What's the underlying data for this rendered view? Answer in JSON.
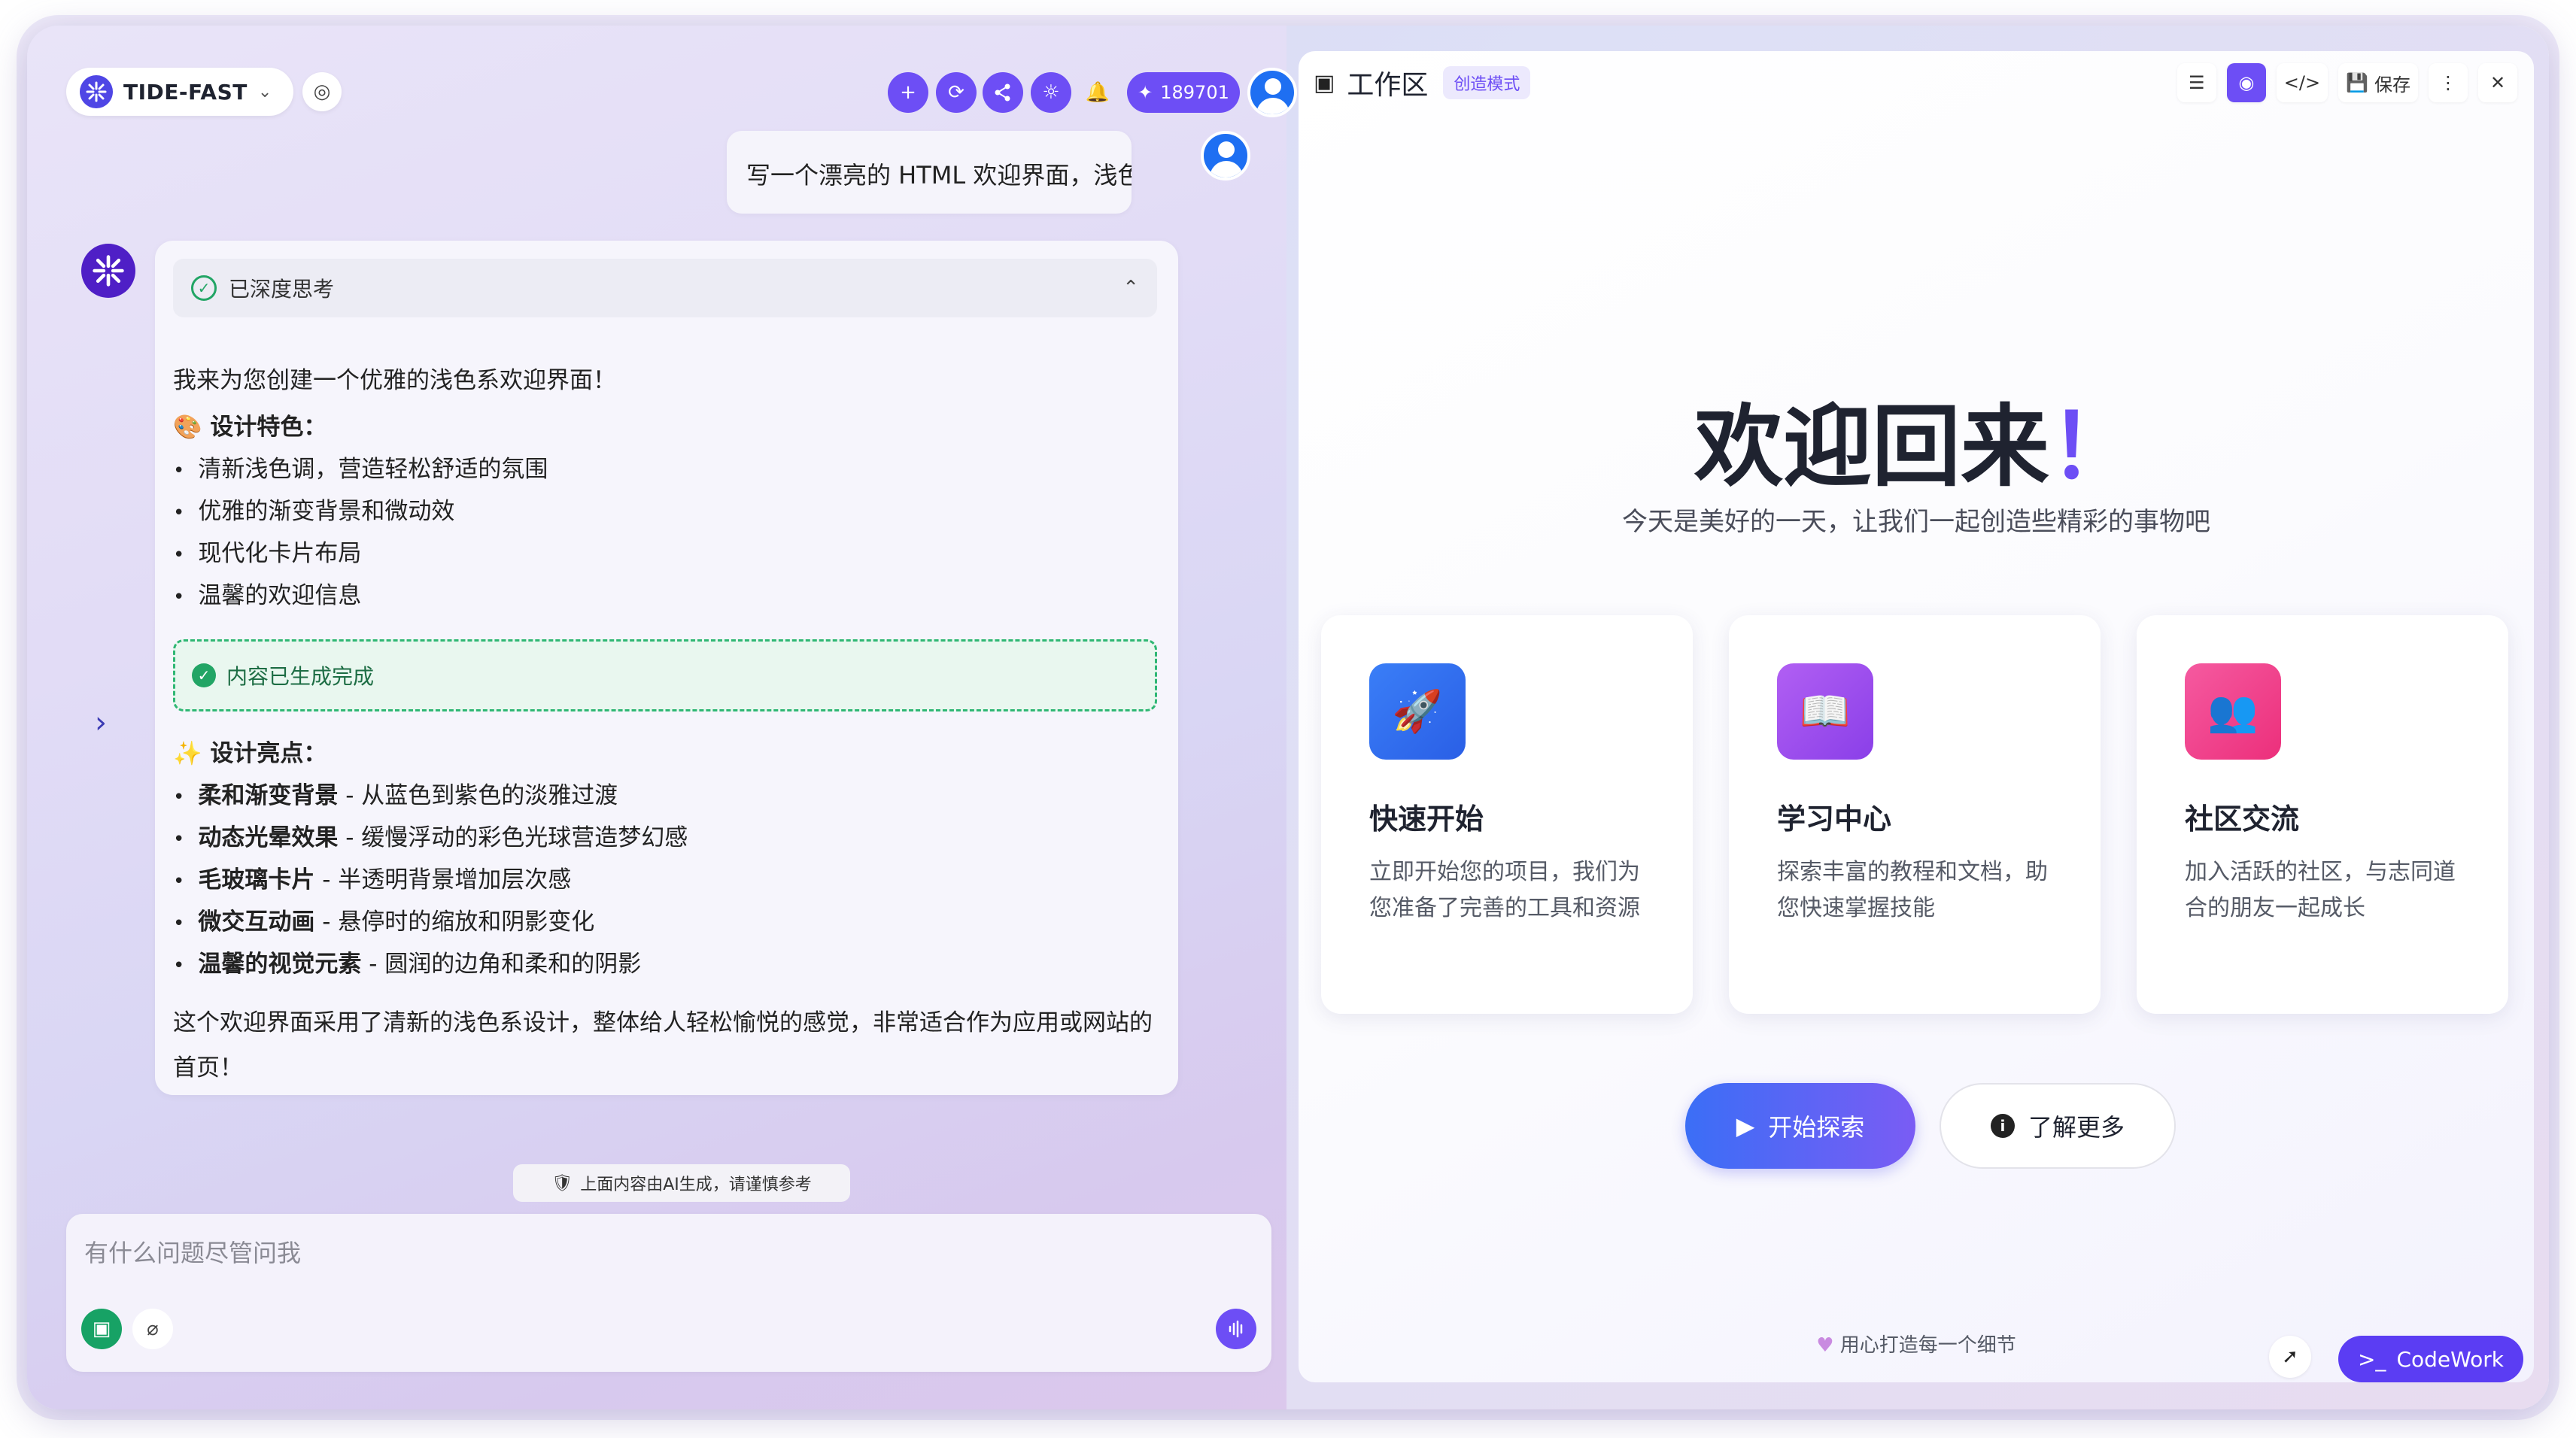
{
  "colors": {
    "accent": "#6d4ef5",
    "success": "#22a565",
    "brand_logo": "#4f46e5",
    "card_blue": "#2f6ff2",
    "card_purple": "#9b4ff0",
    "card_pink": "#f0408a"
  },
  "left": {
    "brand": "TIDE-FAST",
    "credits": "189701",
    "toolbar_icons": [
      "plus-icon",
      "refresh-icon",
      "share-icon",
      "sun-icon",
      "bell-icon",
      "sparkle-icon"
    ],
    "user_message": "写一个漂亮的 HTML 欢迎界面，浅色,",
    "thinking_label": "已深度思考",
    "intro": "我来为您创建一个优雅的浅色系欢迎界面！",
    "features_heading": "🎨 设计特色：",
    "features": [
      "清新浅色调，营造轻松舒适的氛围",
      "优雅的渐变背景和微动效",
      "现代化卡片布局",
      "温馨的欢迎信息"
    ],
    "done_label": "内容已生成完成",
    "highlights_heading": "✨ 设计亮点：",
    "highlights": [
      {
        "title": "柔和渐变背景",
        "desc": " - 从蓝色到紫色的淡雅过渡"
      },
      {
        "title": "动态光晕效果",
        "desc": " - 缓慢浮动的彩色光球营造梦幻感"
      },
      {
        "title": "毛玻璃卡片",
        "desc": " - 半透明背景增加层次感"
      },
      {
        "title": "微交互动画",
        "desc": " - 悬停时的缩放和阴影变化"
      },
      {
        "title": "温馨的视觉元素",
        "desc": " - 圆润的边角和柔和的阴影"
      }
    ],
    "summary": "这个欢迎界面采用了清新的浅色系设计，整体给人轻松愉悦的感觉，非常适合作为应用或网站的首页！",
    "disclaimer": "上面内容由AI生成，请谨慎参考",
    "input_placeholder": "有什么问题尽管问我"
  },
  "right": {
    "title": "工作区",
    "mode": "创造模式",
    "save_label": "保存",
    "hero_title": "欢迎回来",
    "hero_bang": "！",
    "hero_subtitle": "今天是美好的一天，让我们一起创造些精彩的事物吧",
    "cards": [
      {
        "icon": "rocket-icon",
        "title": "快速开始",
        "desc": "立即开始您的项目，我们为您准备了完善的工具和资源"
      },
      {
        "icon": "book-icon",
        "title": "学习中心",
        "desc": "探索丰富的教程和文档，助您快速掌握技能"
      },
      {
        "icon": "users-icon",
        "title": "社区交流",
        "desc": "加入活跃的社区，与志同道合的朋友一起成长"
      }
    ],
    "cta_primary": "开始探索",
    "cta_secondary": "了解更多",
    "footer_note": "用心打造每一个细节",
    "codework_label": "CodeWork"
  }
}
